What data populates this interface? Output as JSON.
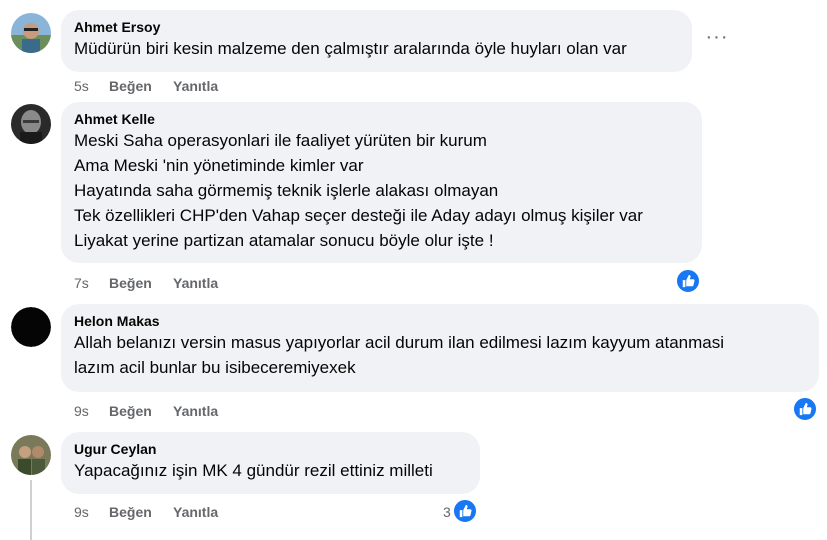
{
  "comments": [
    {
      "author": "Ahmet Ersoy",
      "lines": [
        "Müdürün biri kesin malzeme den çalmıştır aralarında öyle huyları olan var"
      ],
      "time": "5s",
      "like_label": "Beğen",
      "reply_label": "Yanıtla"
    },
    {
      "author": "Ahmet Kelle",
      "lines": [
        "Meski Saha operasyonlari ile faaliyet yürüten bir kurum",
        "Ama Meski 'nin yönetiminde kimler var",
        "Hayatında saha görmemiş teknik işlerle alakası olmayan",
        "Tek özellikleri CHP'den Vahap seçer desteği ile Aday adayı olmuş kişiler var",
        "Liyakat yerine partizan atamalar sonucu böyle olur işte !"
      ],
      "time": "7s",
      "like_label": "Beğen",
      "reply_label": "Yanıtla",
      "reaction": "like-icon"
    },
    {
      "author": "Helon Makas",
      "lines": [
        "Allah belanızı versin masus yapıyorlar acil durum ilan edilmesi lazım kayyum atanmasi",
        "lazım acil bunlar bu isibeceremiyexek"
      ],
      "time": "9s",
      "like_label": "Beğen",
      "reply_label": "Yanıtla",
      "reaction": "like-icon"
    },
    {
      "author": "Ugur Ceylan",
      "lines": [
        "Yapacağınız işin MK 4 gündür rezil ettiniz milleti"
      ],
      "time": "9s",
      "like_label": "Beğen",
      "reply_label": "Yanıtla",
      "reaction": "like-icon",
      "reaction_count": "3"
    }
  ],
  "more_options_icon": "ellipsis-icon",
  "colors": {
    "bubble_bg": "#f0f2f5",
    "meta_text": "#65676b",
    "like_blue": "#1877f2"
  }
}
